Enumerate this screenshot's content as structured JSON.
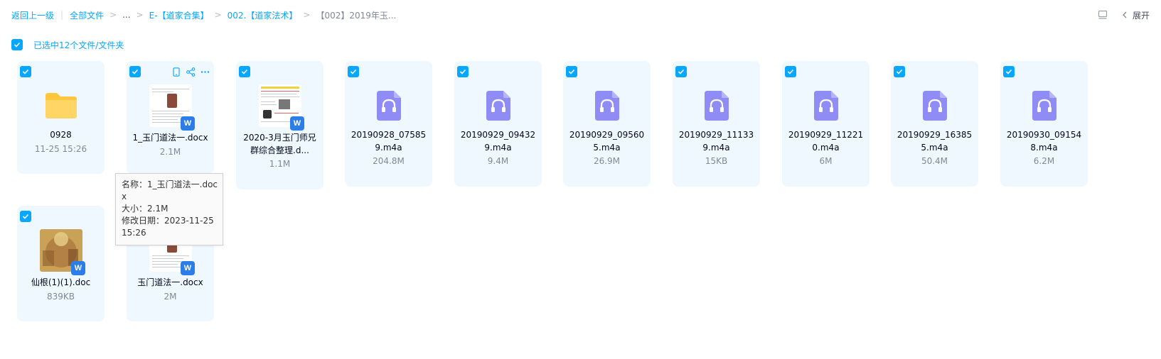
{
  "breadcrumb": {
    "back": "返回上一级",
    "all_files": "全部文件",
    "ellipsis": "...",
    "level1": "E-【道家合集】",
    "level2": "002.【道家法术】",
    "current": "【002】2019年玉..."
  },
  "toolbar": {
    "view_icon": "list-view-icon",
    "expand_label": "展开"
  },
  "selection": {
    "label": "已选中12个文件/文件夹",
    "checked": true
  },
  "files": [
    {
      "name": "0928",
      "meta": "11-25 15:26",
      "type": "folder",
      "icon": "folder-icon"
    },
    {
      "name": "1_玉门道法一.docx",
      "meta": "2.1M",
      "type": "docx",
      "icon": "word-icon"
    },
    {
      "name": "2020-3月玉门师兄群综合整理.d...",
      "meta": "1.1M",
      "type": "docx",
      "icon": "word-icon"
    },
    {
      "name": "20190928_075859.m4a",
      "meta": "204.8M",
      "type": "audio",
      "icon": "audio-file-icon"
    },
    {
      "name": "20190929_094329.m4a",
      "meta": "9.4M",
      "type": "audio",
      "icon": "audio-file-icon"
    },
    {
      "name": "20190929_095605.m4a",
      "meta": "26.9M",
      "type": "audio",
      "icon": "audio-file-icon"
    },
    {
      "name": "20190929_111339.m4a",
      "meta": "15KB",
      "type": "audio",
      "icon": "audio-file-icon"
    },
    {
      "name": "20190929_112210.m4a",
      "meta": "6M",
      "type": "audio",
      "icon": "audio-file-icon"
    },
    {
      "name": "20190929_163855.m4a",
      "meta": "50.4M",
      "type": "audio",
      "icon": "audio-file-icon"
    },
    {
      "name": "20190930_091548.m4a",
      "meta": "6.2M",
      "type": "audio",
      "icon": "audio-file-icon"
    },
    {
      "name": "仙根(1)(1).doc",
      "meta": "839KB",
      "type": "doc",
      "icon": "word-icon"
    },
    {
      "name": "玉门道法一.docx",
      "meta": "2M",
      "type": "docx",
      "icon": "word-icon"
    }
  ],
  "tooltip": {
    "name": "名称：1_玉门道法一.docx",
    "size": "大小：2.1M",
    "modified": "修改日期：2023-11-25 15:26"
  },
  "colors": {
    "accent": "#06a7ff",
    "card_bg": "#eef8fe",
    "audio_icon": "#8f8cf5",
    "folder": "#ffc53d",
    "word_badge": "#2b7de9"
  }
}
